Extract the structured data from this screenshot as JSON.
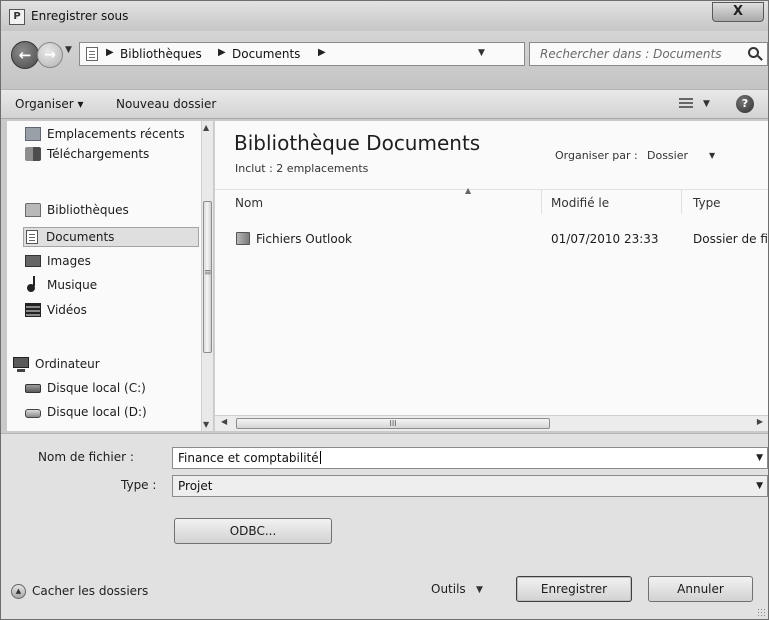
{
  "window": {
    "title": "Enregistrer sous",
    "title_icon": "P",
    "close_label": "X"
  },
  "nav": {
    "back_icon": "←",
    "forward_icon": "→",
    "breadcrumb": [
      "Bibliothèques",
      "Documents"
    ],
    "search_placeholder": "Rechercher dans : Documents"
  },
  "toolbar": {
    "organize_label": "Organiser",
    "new_folder_label": "Nouveau dossier",
    "help_label": "?"
  },
  "sidebar": {
    "items": [
      {
        "label": "Emplacements récents",
        "icon": "recent-places-icon"
      },
      {
        "label": "Téléchargements",
        "icon": "downloads-icon"
      },
      {
        "label": "Bibliothèques",
        "icon": "libraries-icon"
      },
      {
        "label": "Documents",
        "icon": "documents-icon",
        "selected": true
      },
      {
        "label": "Images",
        "icon": "images-icon"
      },
      {
        "label": "Musique",
        "icon": "music-icon"
      },
      {
        "label": "Vidéos",
        "icon": "videos-icon"
      },
      {
        "label": "Ordinateur",
        "icon": "computer-icon"
      },
      {
        "label": "Disque local (C:)",
        "icon": "local-disk-icon"
      },
      {
        "label": "Disque local (D:)",
        "icon": "local-disk-icon"
      }
    ]
  },
  "main": {
    "library_title": "Bibliothèque Documents",
    "library_subtitle": "Inclut : 2 emplacements",
    "arrange_label": "Organiser par :",
    "arrange_value": "Dossier",
    "columns": {
      "name": "Nom",
      "modified": "Modifié le",
      "type": "Type"
    },
    "rows": [
      {
        "name": "Fichiers Outlook",
        "modified": "01/07/2010 23:33",
        "type": "Dossier de fi"
      }
    ],
    "hscroll_grip": "III"
  },
  "form": {
    "filename_label": "Nom de fichier :",
    "filename_value": "Finance et comptabilité",
    "type_label": "Type :",
    "type_value": "Projet",
    "odbc_label": "ODBC...",
    "hide_folders_label": "Cacher les dossiers",
    "tools_label": "Outils",
    "save_label": "Enregistrer",
    "cancel_label": "Annuler"
  }
}
